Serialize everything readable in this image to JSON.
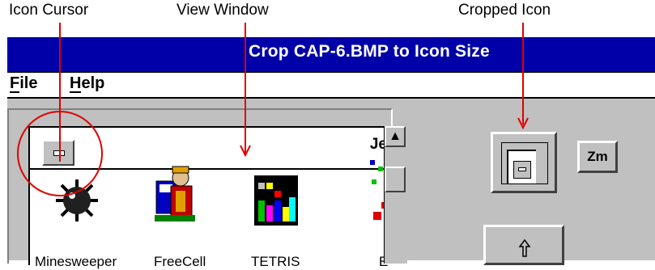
{
  "callouts": {
    "icon_cursor": "Icon Cursor",
    "view_window": "View Window",
    "cropped_icon": "Cropped Icon"
  },
  "window": {
    "title": "Crop CAP-6.BMP to Icon Size"
  },
  "menu": {
    "file": "File",
    "help": "Help"
  },
  "view": {
    "mini_title": "Je",
    "apps": [
      {
        "label": "Minesweeper",
        "icon": "minesweeper-icon"
      },
      {
        "label": "FreeCell",
        "icon": "freecell-icon"
      },
      {
        "label": "TETRIS",
        "icon": "tetris-icon"
      },
      {
        "label": "E",
        "icon": "partial-app-icon"
      }
    ]
  },
  "controls": {
    "zoom": "Zm"
  },
  "colors": {
    "titlebar": "#0000a8",
    "annotation": "#e00000",
    "client": "#c0c0c0"
  }
}
